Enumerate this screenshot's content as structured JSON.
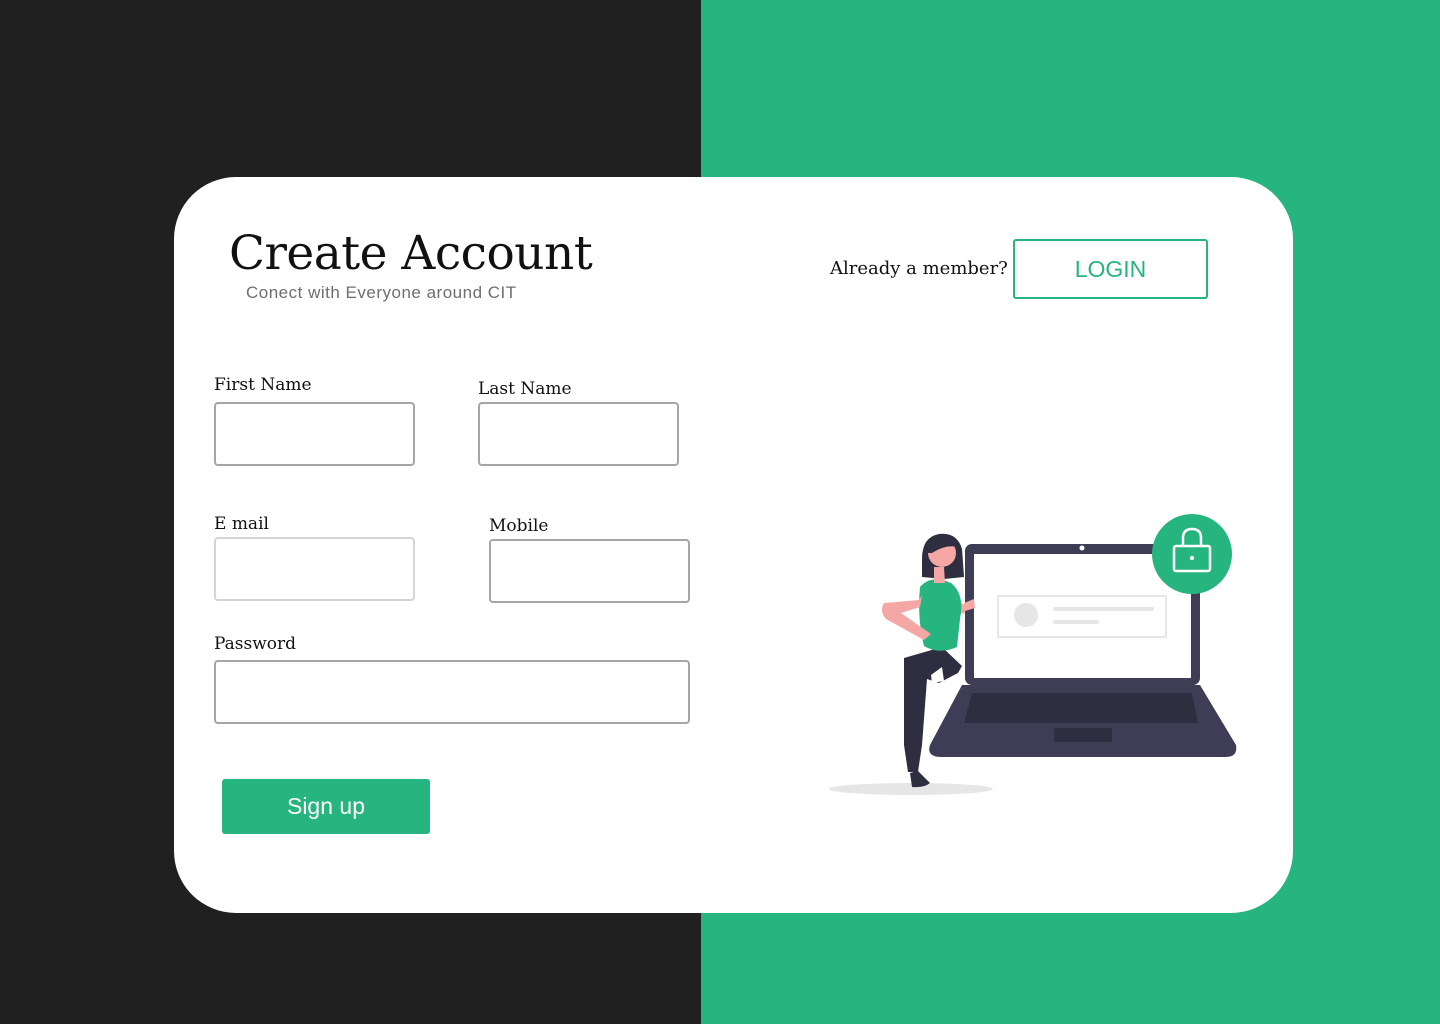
{
  "header": {
    "title": "Create Account",
    "subtitle": "Conect with Everyone around CIT"
  },
  "auth": {
    "member_prompt": "Already a member?",
    "login_label": "LOGIN"
  },
  "form": {
    "first_name": {
      "label": "First Name",
      "value": "",
      "placeholder": ""
    },
    "last_name": {
      "label": "Last Name",
      "value": "",
      "placeholder": ""
    },
    "email": {
      "label": "E mail",
      "value": "",
      "placeholder": ""
    },
    "mobile": {
      "label": "Mobile",
      "value": "",
      "placeholder": ""
    },
    "password": {
      "label": "Password",
      "value": "",
      "placeholder": ""
    },
    "submit_label": "Sign up"
  },
  "illustration": {
    "icon": "lock-icon",
    "subject": "woman-with-laptop"
  },
  "colors": {
    "accent": "#26b57f",
    "left_background": "#202020",
    "card": "#ffffff",
    "input_border": "#a6a6a6",
    "laptop": "#3f3d56",
    "skin": "#f4a7a5"
  }
}
